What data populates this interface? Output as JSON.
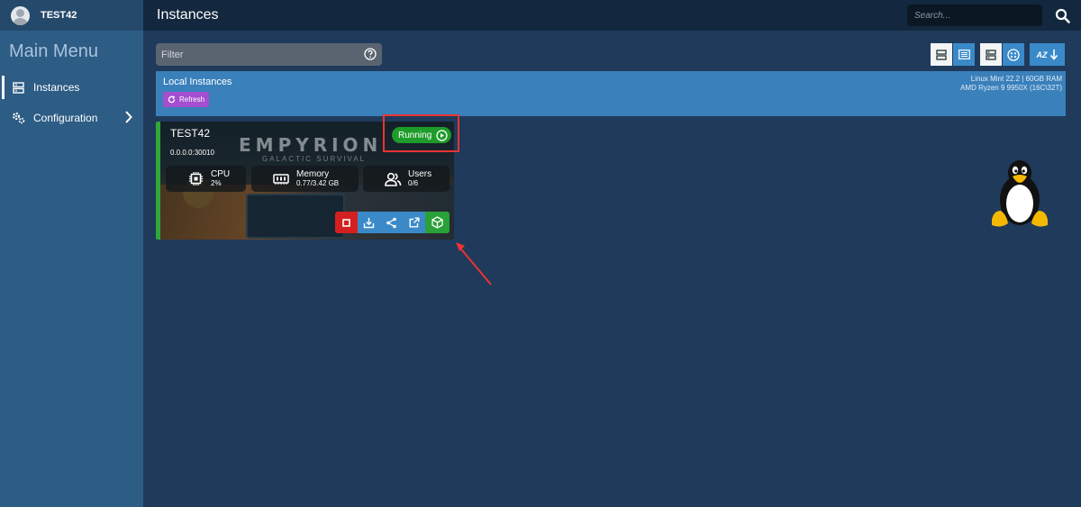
{
  "sidebar": {
    "username": "TEST42",
    "menu_title": "Main Menu",
    "items": [
      {
        "label": "Instances",
        "icon": "server-icon",
        "active": true
      },
      {
        "label": "Configuration",
        "icon": "gears-icon",
        "has_submenu": true
      }
    ]
  },
  "header": {
    "title": "Instances",
    "search_placeholder": "Search..."
  },
  "filter": {
    "placeholder": "Filter"
  },
  "view_controls": [
    {
      "icon": "list-layout-icon"
    },
    {
      "icon": "detail-list-icon",
      "active": true
    },
    {
      "icon": "server-list-icon"
    },
    {
      "icon": "circle-grid-icon",
      "active": true
    },
    {
      "icon": "sort-az-down-icon",
      "label": "AZ"
    }
  ],
  "local_instances": {
    "title": "Local Instances",
    "refresh_label": "Refresh",
    "system_info_line1": "Linux Mint 22.2 | 60GB RAM",
    "system_info_line2": "AMD Ryzen 9 9950X (16C\\32T)"
  },
  "instance": {
    "name": "TEST42",
    "address": "0.0.0.0:30010",
    "game_logo": "EMPYRION",
    "game_subtitle": "GALACTIC SURVIVAL",
    "status": "Running",
    "stats": [
      {
        "label": "CPU",
        "value": "2%",
        "icon": "cpu-icon"
      },
      {
        "label": "Memory",
        "value": "0.77/3.42 GB",
        "icon": "memory-icon"
      },
      {
        "label": "Users",
        "value": "0/6",
        "icon": "users-icon"
      }
    ],
    "actions": [
      {
        "icon": "stop-icon",
        "color": "#d42020"
      },
      {
        "icon": "update-download-icon",
        "color": "#3a8ac9"
      },
      {
        "icon": "share-icon",
        "color": "#3a8ac9"
      },
      {
        "icon": "open-external-icon",
        "color": "#3a8ac9"
      },
      {
        "icon": "package-icon",
        "color": "#2aa038"
      }
    ]
  },
  "colors": {
    "sidebar": "#2d5c85",
    "topbar": "#13283e",
    "content": "#1f3a5a",
    "banner": "#3a80bb",
    "running": "#1e9c2a",
    "highlight": "#e33333"
  }
}
